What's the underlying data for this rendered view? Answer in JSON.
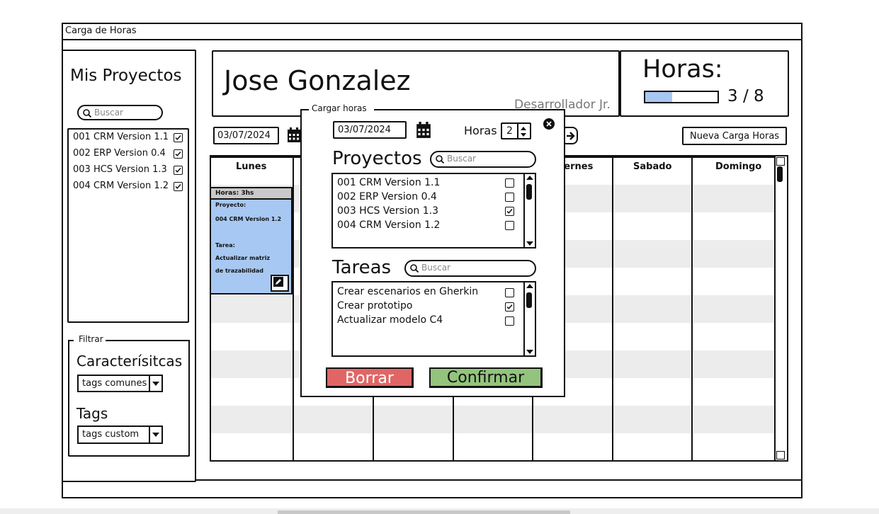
{
  "window": {
    "title": "Carga de Horas"
  },
  "sidebar": {
    "title": "Mis Proyectos",
    "search_placeholder": "Buscar",
    "projects": [
      {
        "label": "001 CRM  Version 1.1",
        "checked": true
      },
      {
        "label": "002 ERP Version 0.4",
        "checked": true
      },
      {
        "label": "003 HCS Version 1.3",
        "checked": true
      },
      {
        "label": "004 CRM Version 1.2",
        "checked": true
      }
    ],
    "filter": {
      "legend": "Filtrar",
      "caracteristicas_label": "Caracterísitcas",
      "caracteristicas_value": "tags comunes",
      "tags_label": "Tags",
      "tags_value": "tags custom"
    }
  },
  "header": {
    "user_name": "Jose Gonzalez",
    "role": "Desarrollador Jr.",
    "hours_label": "Horas:",
    "hours_value": "3 / 8",
    "hours_progress": 0.375
  },
  "toolbar": {
    "date": "03/07/2024",
    "new_entry_button": "Nueva Carga Horas"
  },
  "calendar": {
    "days": [
      "Lunes",
      "",
      "",
      "",
      "Viernes",
      "Sabado",
      "Domingo"
    ],
    "event": {
      "hours": "Horas: 3hs",
      "project_label": "Proyecto:",
      "project": "004 CRM Version 1.2",
      "task_label": "Tarea:",
      "task_line1": "Actualizar matriz",
      "task_line2": "de trazabilidad"
    }
  },
  "modal": {
    "title": "Cargar horas",
    "date": "03/07/2024",
    "hours_label": "Horas",
    "hours_value": "2",
    "projects_heading": "Proyectos",
    "projects_search_placeholder": "Buscar",
    "projects": [
      {
        "label": "001 CRM Version 1.1",
        "checked": false
      },
      {
        "label": "002 ERP Version 0.4",
        "checked": false
      },
      {
        "label": "003 HCS Version 1.3",
        "checked": true
      },
      {
        "label": "004 CRM Version 1.2",
        "checked": false
      }
    ],
    "tasks_heading": "Tareas",
    "tasks_search_placeholder": "Buscar",
    "tasks": [
      {
        "label": "Crear escenarios en Gherkin",
        "checked": false
      },
      {
        "label": "Crear prototipo",
        "checked": true
      },
      {
        "label": "Actualizar modelo C4",
        "checked": false
      }
    ],
    "delete_button": "Borrar",
    "confirm_button": "Confirmar"
  },
  "colors": {
    "event_fill": "#a7c8f2",
    "delete_button": "#e06666",
    "confirm_button": "#93c47d",
    "stripe": "#ececec"
  }
}
